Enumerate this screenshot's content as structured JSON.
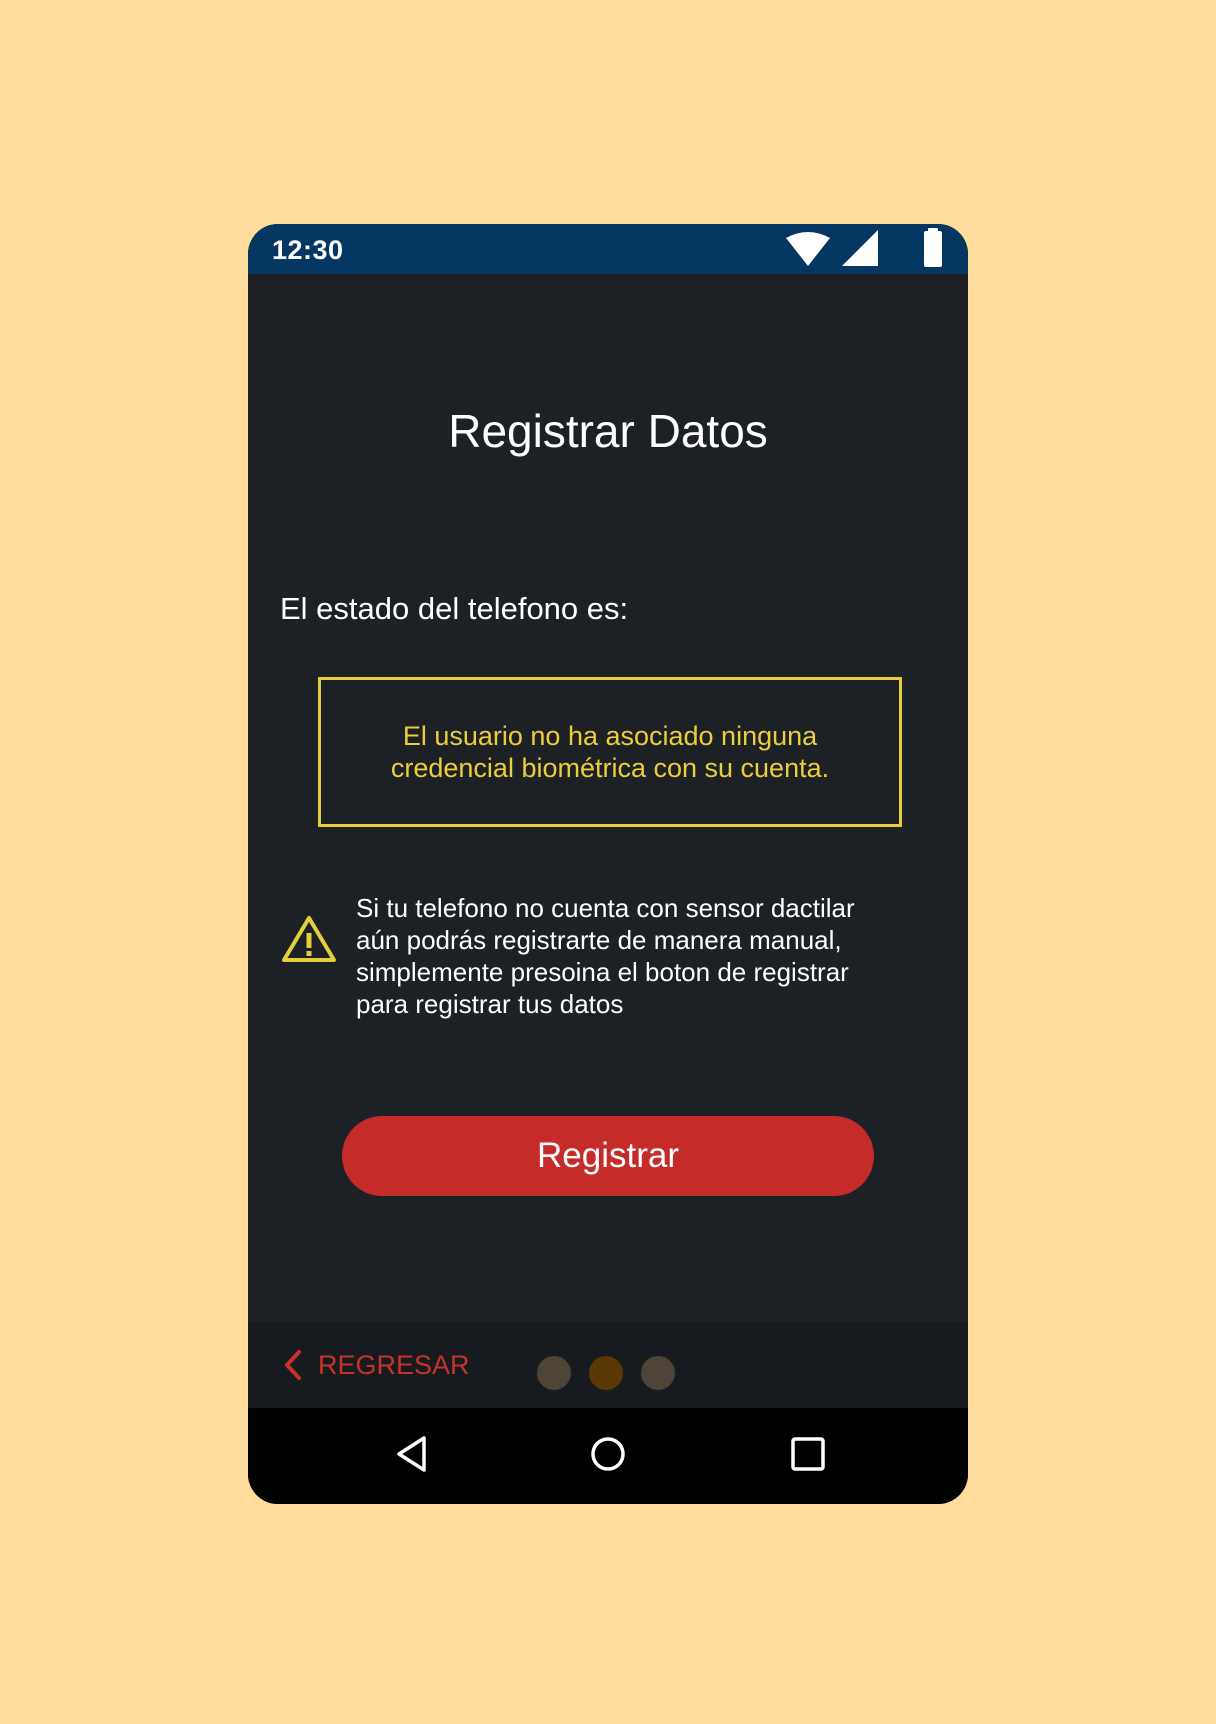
{
  "status_bar": {
    "time": "12:30",
    "icons": [
      "wifi-icon",
      "signal-icon",
      "battery-icon"
    ]
  },
  "screen": {
    "title": "Registrar Datos",
    "status_label": "El estado del telefono es:",
    "status_message": "El usuario no ha asociado ninguna credencial biométrica con su cuenta.",
    "warning_icon": "warning-triangle-icon",
    "warning_message": "Si tu telefono no cuenta con sensor dactilar aún podrás registrarte de manera manual, simplemente presoina el boton de registrar para registrar tus datos",
    "register_button_label": "Registrar"
  },
  "bottom_bar": {
    "back_label": "REGRESAR",
    "back_icon": "chevron-left-icon",
    "pager": {
      "total": 3,
      "active_index": 1
    }
  },
  "nav_bar": {
    "icons": [
      "back-triangle-icon",
      "home-circle-icon",
      "recents-square-icon"
    ]
  },
  "colors": {
    "page_background": "#FFDC9C",
    "status_bar": "#043762",
    "screen_background": "#1D2125",
    "accent_yellow": "#E3CF3C",
    "button_red": "#C52B28",
    "back_red": "#C5332A",
    "pager_dot": "#4E4437",
    "pager_dot_active": "#5A3905"
  }
}
